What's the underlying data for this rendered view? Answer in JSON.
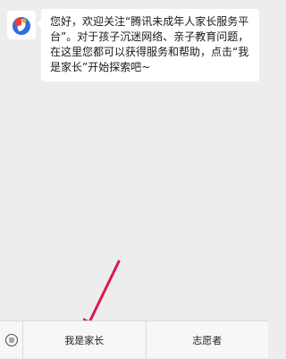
{
  "chat": {
    "avatar_icon": "tencent-guardian-logo-icon",
    "message": "您好，欢迎关注“腾讯未成年人家长服务平台”。对于孩子沉迷网络、亲子教育问题，在这里您都可以获得服务和帮助，点击“我是家长”开始探索吧~"
  },
  "bottom_menu": {
    "toggle_icon": "keyboard-toggle-icon",
    "items": [
      {
        "label": "我是家长"
      },
      {
        "label": "志愿者"
      }
    ]
  },
  "colors": {
    "arrow": "#d81b4a",
    "logo_blue": "#2f6fd6",
    "logo_red": "#e8433a",
    "logo_orange": "#f5a623"
  }
}
